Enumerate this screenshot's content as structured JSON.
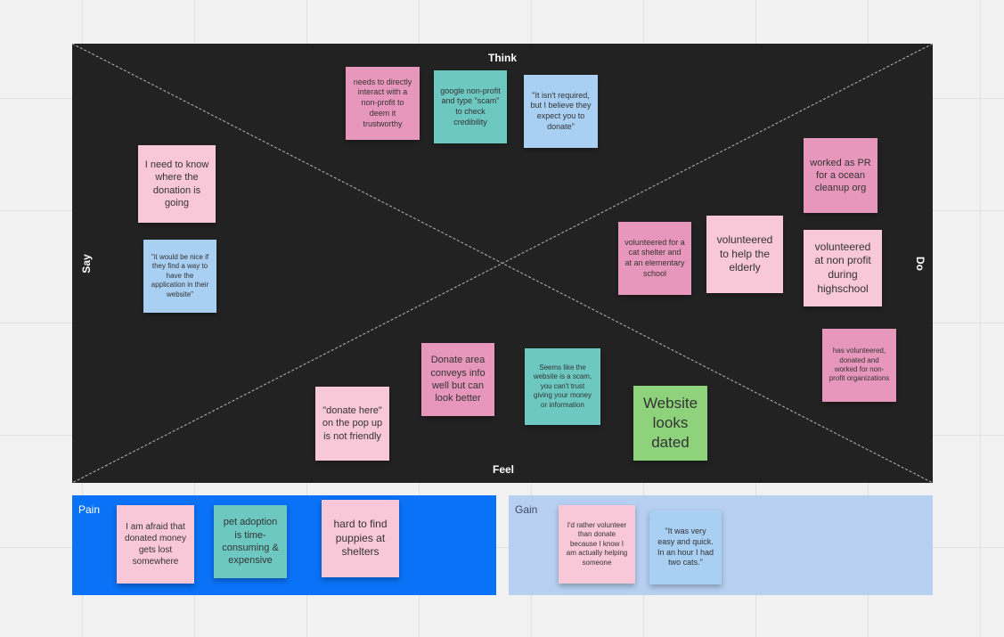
{
  "board": {
    "think": "Think",
    "feel": "Feel",
    "say": "Say",
    "do": "Do"
  },
  "think_notes": [
    "needs to directly interact with a non-profit to deem it trustworthy",
    "google non-profit and type \"scam\" to check credibility",
    "\"It isn't required, but I believe they expect you to donate\""
  ],
  "say_notes": [
    "I need to know where the donation is going",
    "\"it would be nice if they find a way to have the application in their website\""
  ],
  "do_notes": [
    "worked as PR for a ocean cleanup org",
    "volunteered for a cat shelter and at an elementary school",
    "volunteered to help the elderly",
    "volunteered at non profit during highschool",
    "has volunteered, donated and worked for non-profit organizations"
  ],
  "feel_notes": [
    "Donate area conveys info well but can look better",
    "Seems like the website is a scam, you can't trust giving your money or information",
    "\"donate here\" on the pop up is not friendly",
    "Website looks dated"
  ],
  "pain": {
    "label": "Pain",
    "notes": [
      "I am afraid that donated money gets lost somewhere",
      "pet adoption is time-consuming & expensive",
      "hard to find puppies at shelters"
    ]
  },
  "gain": {
    "label": "Gain",
    "notes": [
      "I'd rather volunteer than donate because I know I am actually helping someone",
      "\"It was very easy and quick. In an hour I had two cats.\""
    ]
  },
  "colors": {
    "board": "#222222",
    "pink": "#f8c7d8",
    "magenta": "#e897bc",
    "blue": "#a9cff3",
    "teal": "#6ec8c2",
    "green": "#8ed27c",
    "pain": "#0a72f6",
    "gain": "#b7d0f2"
  }
}
